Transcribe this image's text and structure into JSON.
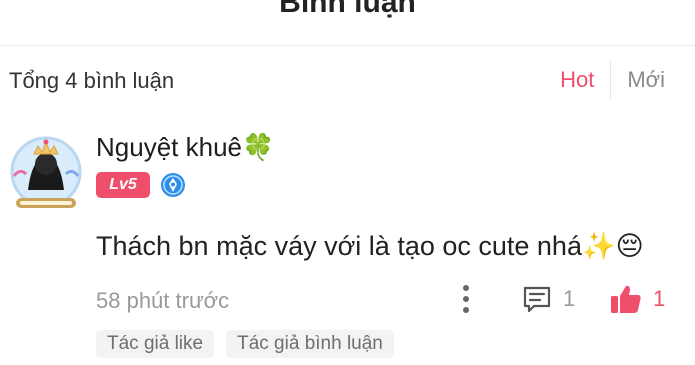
{
  "header": {
    "title": "Bình luận"
  },
  "summary": {
    "total_label": "Tổng 4 bình luận"
  },
  "sort": {
    "hot_label": "Hot",
    "new_label": "Mới",
    "active": "Hot",
    "active_color": "#f0506e"
  },
  "comment": {
    "username": "Nguyệt khuê🍀",
    "level_badge": "Lv5",
    "text": "Thách bn mặc váy với là tạo oc cute nhá✨😔",
    "time": "58 phút trước",
    "reply_count": "1",
    "like_count": "1",
    "liked": true,
    "tags": [
      "Tác giả like",
      "Tác giả bình luận"
    ]
  },
  "colors": {
    "accent": "#ef4f6b",
    "muted": "#9a9a9a",
    "vip_blue": "#2f8fe8"
  },
  "icons": [
    "avatar-frame",
    "vip-badge-icon",
    "more-vertical-icon",
    "reply-comment-icon",
    "thumbs-up-icon"
  ]
}
